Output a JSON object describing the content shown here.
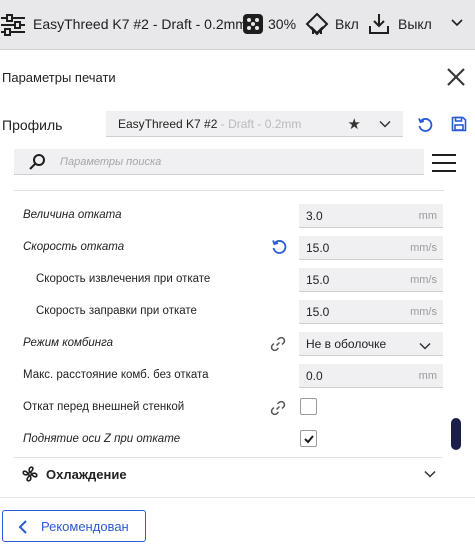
{
  "topbar": {
    "profile_text": "EasyThreed K7 #2 - Draft - 0.2mm",
    "infill_text": "30%",
    "support_text": "Вкл",
    "adhesion_text": "Выкл",
    "icons": [
      "sliders-icon",
      "infill-icon",
      "support-icon",
      "adhesion-icon",
      "chevron-down-icon"
    ]
  },
  "panel": {
    "title": "Параметры печати"
  },
  "profile": {
    "label": "Профиль",
    "name": "EasyThreed K7 #2",
    "suffix": " - Draft - 0.2mm"
  },
  "search": {
    "placeholder": "Параметры поиска"
  },
  "settings": [
    {
      "label": "Величина отката",
      "value": "3.0",
      "unit": "mm",
      "italic": true
    },
    {
      "label": "Скорость отката",
      "value": "15.0",
      "unit": "mm/s",
      "italic": true
    },
    {
      "label": "Скорость извлечения при откате",
      "value": "15.0",
      "unit": "mm/s",
      "italic": false
    },
    {
      "label": "Скорость заправки при откате",
      "value": "15.0",
      "unit": "mm/s",
      "italic": false
    },
    {
      "label": "Режим комбинга",
      "value": "Не в оболочке",
      "italic": true
    },
    {
      "label": "Макс. расстояние комб. без отката",
      "value": "0.0",
      "unit": "mm",
      "italic": false
    },
    {
      "label": "Откат перед внешней стенкой",
      "checked": false,
      "italic": false
    },
    {
      "label": "Поднятие оси Z при откате",
      "checked": true,
      "italic": true
    }
  ],
  "section": {
    "label": "Охлаждение"
  },
  "footer": {
    "recommended_label": "Рекомендован"
  },
  "colors": {
    "accent": "#2a5bd7",
    "scrollbar": "#1b1f4a",
    "topbar_bg": "#e8e8ea"
  }
}
